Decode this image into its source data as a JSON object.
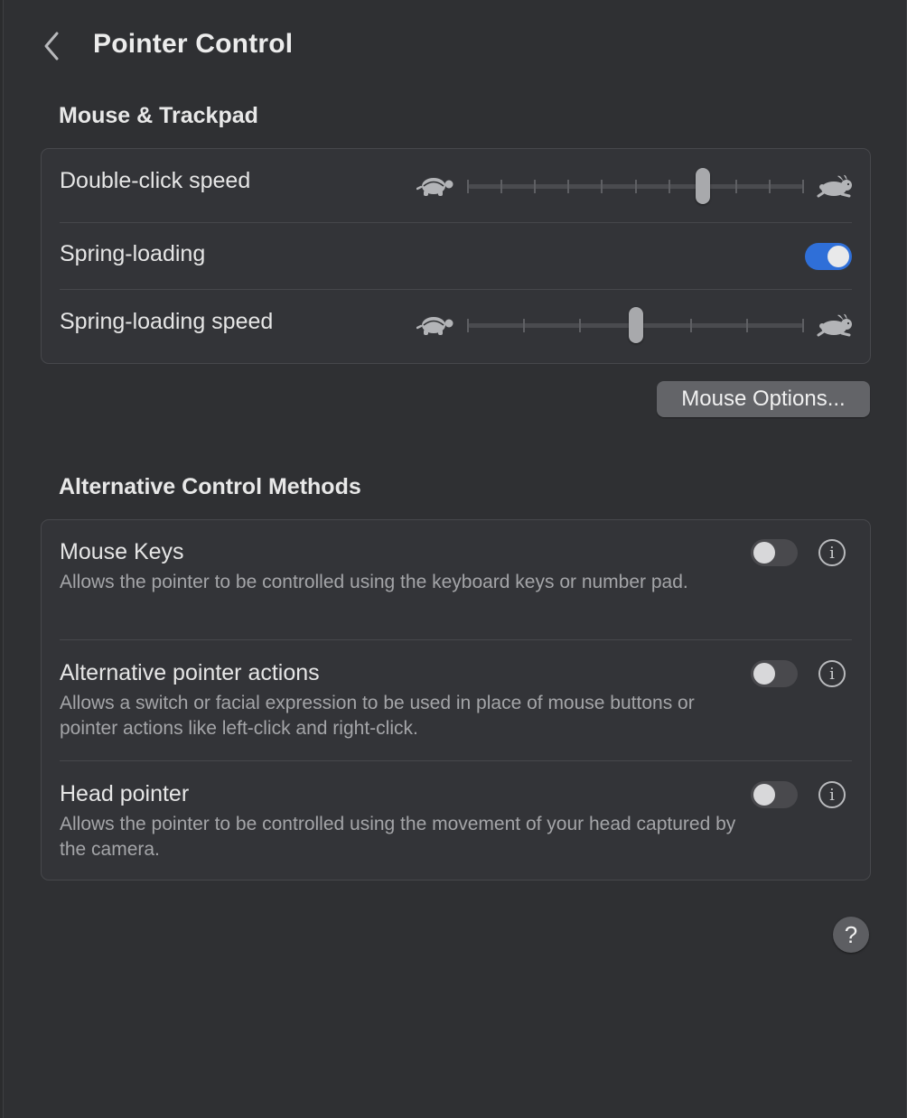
{
  "header": {
    "title": "Pointer Control",
    "back_icon": "chevron-left-icon"
  },
  "mouse_trackpad": {
    "section_title": "Mouse & Trackpad",
    "double_click_speed": {
      "label": "Double-click speed",
      "value_index": 7,
      "steps": 11,
      "slow_icon": "turtle-icon",
      "fast_icon": "rabbit-icon"
    },
    "spring_loading": {
      "label": "Spring-loading",
      "enabled": true
    },
    "spring_loading_speed": {
      "label": "Spring-loading speed",
      "value_index": 3,
      "steps": 7,
      "slow_icon": "turtle-icon",
      "fast_icon": "rabbit-icon"
    }
  },
  "mouse_options_button": "Mouse Options...",
  "alternative": {
    "section_title": "Alternative Control Methods",
    "items": [
      {
        "label": "Mouse Keys",
        "description": "Allows the pointer to be controlled using the keyboard keys or number pad.",
        "enabled": false
      },
      {
        "label": "Alternative pointer actions",
        "description": "Allows a switch or facial expression to be used in place of mouse buttons or pointer actions like left-click and right-click.",
        "enabled": false
      },
      {
        "label": "Head pointer",
        "description": "Allows the pointer to be controlled using the movement of your head captured by the camera.",
        "enabled": false
      }
    ]
  },
  "help_button": "?",
  "info_glyph": "i",
  "colors": {
    "accent": "#2f6fd8",
    "background": "#2f3033"
  }
}
